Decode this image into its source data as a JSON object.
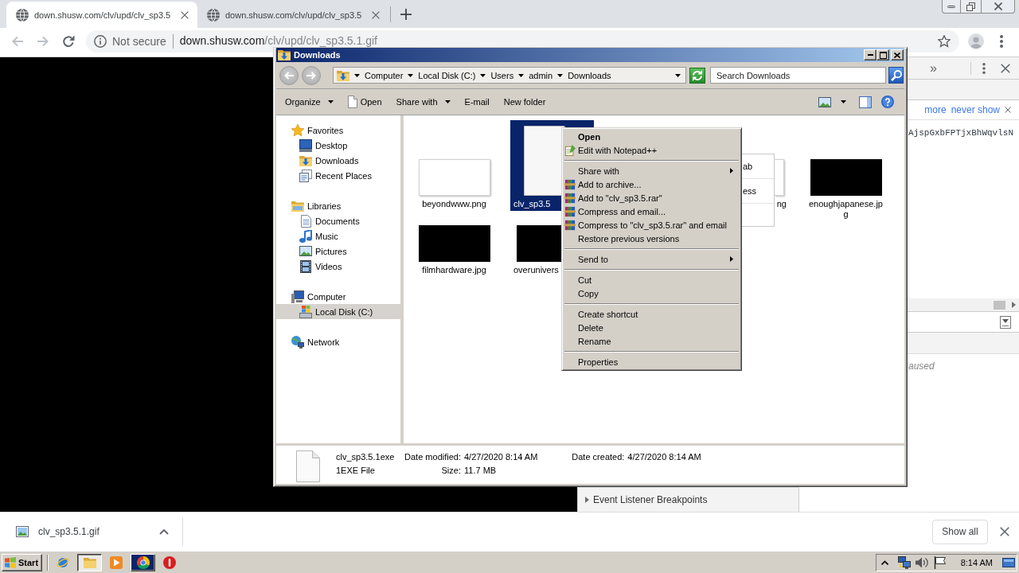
{
  "browser": {
    "tabs": [
      {
        "title": "down.shusw.com/clv/upd/clv_sp3.5",
        "selected": true
      },
      {
        "title": "down.shusw.com/clv/upd/clv_sp3.5",
        "selected": false
      }
    ],
    "history": {
      "back_disabled": true,
      "forward_disabled": true
    },
    "address_bar": {
      "security": "Not secure",
      "host": "down.shusw.com",
      "path": "/clv/upd/clv_sp3.5.1.gif"
    }
  },
  "devtools": {
    "overflow": "»",
    "infobar_links": [
      "more",
      "never show"
    ],
    "console_line": "AjspGxbFPTjxBhWqvlsN",
    "status": "aused",
    "section": {
      "title": "Event Listener Breakpoints",
      "expanded": false
    }
  },
  "explorer": {
    "title": "Downloads",
    "history": {
      "back_disabled": true,
      "forward_disabled": true
    },
    "breadcrumb": [
      "Computer",
      "Local Disk (C:)",
      "Users",
      "admin",
      "Downloads"
    ],
    "search": {
      "placeholder": "Search Downloads"
    },
    "toolbar": [
      {
        "label": "Organize",
        "dropdown": true
      },
      {
        "label": "Open",
        "dropdown": false
      },
      {
        "label": "Share with",
        "dropdown": true
      },
      {
        "label": "E-mail",
        "dropdown": false
      },
      {
        "label": "New folder",
        "dropdown": false
      }
    ],
    "nav": [
      {
        "label": "Favorites",
        "selected": false,
        "children": [
          {
            "label": "Desktop",
            "selected": false
          },
          {
            "label": "Downloads",
            "selected": false
          },
          {
            "label": "Recent Places",
            "selected": false
          }
        ]
      },
      {
        "label": "Libraries",
        "selected": false,
        "children": [
          {
            "label": "Documents",
            "selected": false
          },
          {
            "label": "Music",
            "selected": false
          },
          {
            "label": "Pictures",
            "selected": false
          },
          {
            "label": "Videos",
            "selected": false
          }
        ]
      },
      {
        "label": "Computer",
        "selected": false,
        "children": [
          {
            "label": "Local Disk (C:)",
            "selected": true
          }
        ]
      },
      {
        "label": "Network",
        "selected": false
      }
    ],
    "files": [
      {
        "name": "beyondwww.png",
        "kind": "light",
        "cut_end": false,
        "cut_start": false,
        "selected": false
      },
      {
        "name": "clv_sp3.5",
        "kind": "document",
        "cut_end": true,
        "cut_start": false,
        "selected": true
      },
      {
        "name": "ng",
        "kind": "light",
        "cut_end": false,
        "cut_start": true,
        "selected": false
      },
      {
        "name": "enoughjapanese.jpg",
        "kind": "dark",
        "cut_end": false,
        "cut_start": false,
        "selected": false
      },
      {
        "name": "filmhardware.jpg",
        "kind": "dark",
        "cut_end": false,
        "cut_start": false,
        "selected": false
      },
      {
        "name": "overunivers",
        "kind": "dark",
        "cut_end": true,
        "cut_start": false,
        "selected": false
      }
    ],
    "details": {
      "name": "clv_sp3.5.1exe",
      "type": "1EXE File",
      "properties": [
        {
          "label": "Date modified:",
          "value": "4/27/2020 8:14 AM"
        },
        {
          "label": "Size:",
          "value": "11.7 MB"
        },
        {
          "label": "Date created:",
          "value": "4/27/2020 8:14 AM"
        }
      ]
    }
  },
  "popup": {
    "items": [
      "ab",
      "ess"
    ]
  },
  "context_menu": {
    "groups": [
      {
        "items": [
          {
            "label": "Open",
            "kind": "command",
            "default": true
          },
          {
            "label": "Edit with Notepad++",
            "kind": "command",
            "default": false
          }
        ]
      },
      {
        "items": [
          {
            "label": "Share with",
            "kind": "submenu",
            "default": false
          },
          {
            "label": "Add to archive...",
            "kind": "command",
            "default": false
          },
          {
            "label": "Add to \"clv_sp3.5.rar\"",
            "kind": "command",
            "default": false
          },
          {
            "label": "Compress and email...",
            "kind": "command",
            "default": false
          },
          {
            "label": "Compress to \"clv_sp3.5.rar\" and email",
            "kind": "command",
            "default": false
          },
          {
            "label": "Restore previous versions",
            "kind": "command",
            "default": false
          }
        ]
      },
      {
        "items": [
          {
            "label": "Send to",
            "kind": "submenu",
            "default": false
          }
        ]
      },
      {
        "items": [
          {
            "label": "Cut",
            "kind": "command",
            "default": false
          },
          {
            "label": "Copy",
            "kind": "command",
            "default": false
          }
        ]
      },
      {
        "items": [
          {
            "label": "Create shortcut",
            "kind": "command",
            "default": false
          },
          {
            "label": "Delete",
            "kind": "command",
            "default": false
          },
          {
            "label": "Rename",
            "kind": "command",
            "default": false
          }
        ]
      },
      {
        "items": [
          {
            "label": "Properties",
            "kind": "command",
            "default": false
          }
        ]
      }
    ]
  },
  "download_bar": {
    "items": [
      {
        "name": "clv_sp3.5.1.gif"
      }
    ],
    "show_all": "Show all"
  },
  "taskbar": {
    "start": "Start",
    "apps": [
      {
        "kind": "launcher",
        "selected": false,
        "flashing": false
      },
      {
        "kind": "task",
        "selected": true,
        "flashing": false
      },
      {
        "kind": "launcher",
        "selected": false,
        "flashing": false
      },
      {
        "kind": "task",
        "selected": false,
        "flashing": true
      },
      {
        "kind": "launcher",
        "selected": false,
        "flashing": false
      }
    ],
    "clock": "8:14 AM"
  }
}
